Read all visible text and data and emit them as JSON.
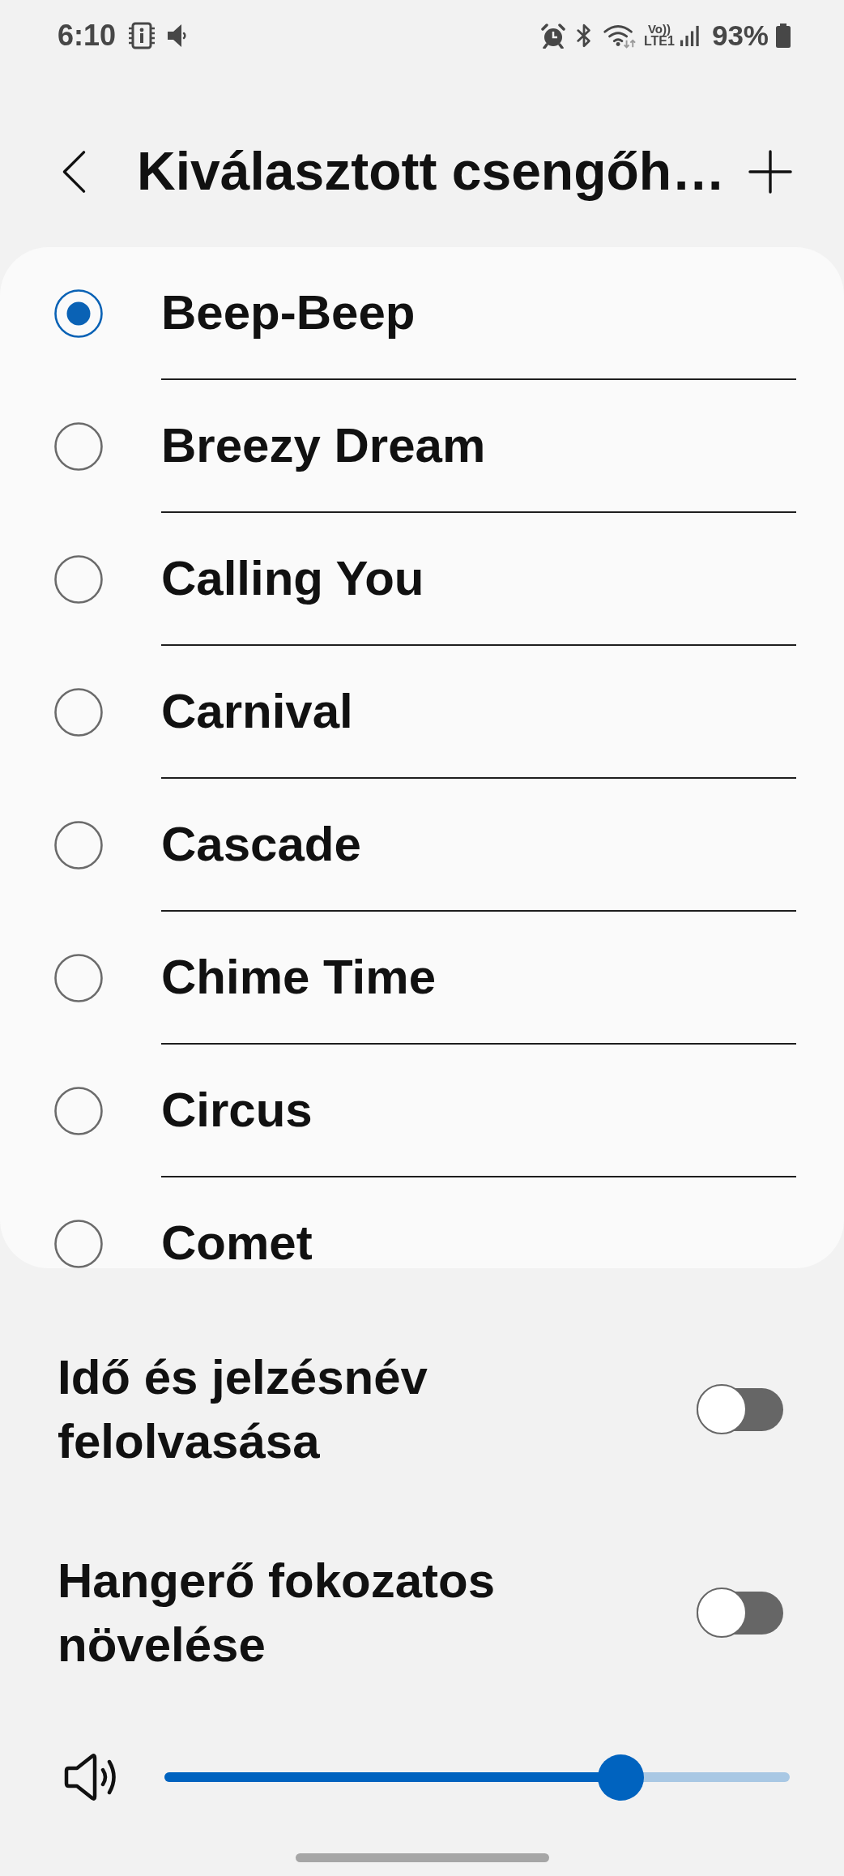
{
  "status_bar": {
    "time": "6:10",
    "volte": "Vo))",
    "network": "LTE1",
    "battery": "93%"
  },
  "header": {
    "title": "Kiválasztott csengőh…"
  },
  "ringtones": [
    {
      "name": "Beep-Beep",
      "selected": true
    },
    {
      "name": "Breezy Dream",
      "selected": false
    },
    {
      "name": "Calling You",
      "selected": false
    },
    {
      "name": "Carnival",
      "selected": false
    },
    {
      "name": "Cascade",
      "selected": false
    },
    {
      "name": "Chime Time",
      "selected": false
    },
    {
      "name": "Circus",
      "selected": false
    },
    {
      "name": "Comet",
      "selected": false
    }
  ],
  "options": [
    {
      "label": "Idő és jelzésnév felolvasása",
      "on": false
    },
    {
      "label": "Hangerő fokozatos növelése",
      "on": false
    }
  ],
  "volume": {
    "level": 0.73
  }
}
